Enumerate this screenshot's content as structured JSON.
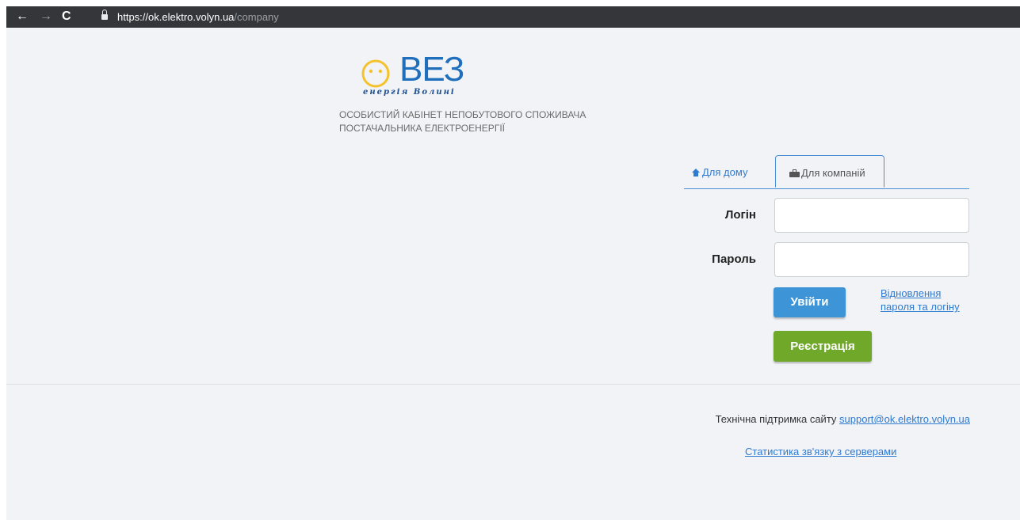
{
  "browser": {
    "url_host": "https://ok.elektro.volyn.ua",
    "url_path": "/company",
    "back_icon": "←",
    "forward_icon": "→",
    "reload_icon": "C"
  },
  "header": {
    "logo_text": "ВЕЗ",
    "logo_subtitle": "енергія Волині",
    "cabinet_title_line1": "ОСОБИСТИЙ КАБІНЕТ НЕПОБУТОВОГО СПОЖИВАЧА",
    "cabinet_title_line2": "ПОСТАЧАЛЬНИКА ЕЛЕКТРОЕНЕРГІЇ"
  },
  "tabs": {
    "home": "Для дому",
    "company": "Для компаній",
    "active": "company"
  },
  "form": {
    "login_label": "Логін",
    "login_value": "",
    "password_label": "Пароль",
    "password_value": "",
    "submit_label": "Увійти",
    "register_label": "Реєстрація",
    "restore_line1": "Відновлення",
    "restore_line2": "пароля та логіну"
  },
  "footer": {
    "support_text": "Технічна підтримка сайту",
    "support_email": "support@ok.elektro.volyn.ua",
    "stats_link": "Статистика зв'язку з серверами"
  },
  "colors": {
    "accent": "#3d95d8",
    "register": "#70a82a",
    "logo_blue": "#1f6fbd",
    "logo_yellow": "#f4c22b"
  },
  "icons": {
    "home_tab": "home-icon",
    "company_tab": "briefcase-icon",
    "lock": "lock-icon"
  }
}
